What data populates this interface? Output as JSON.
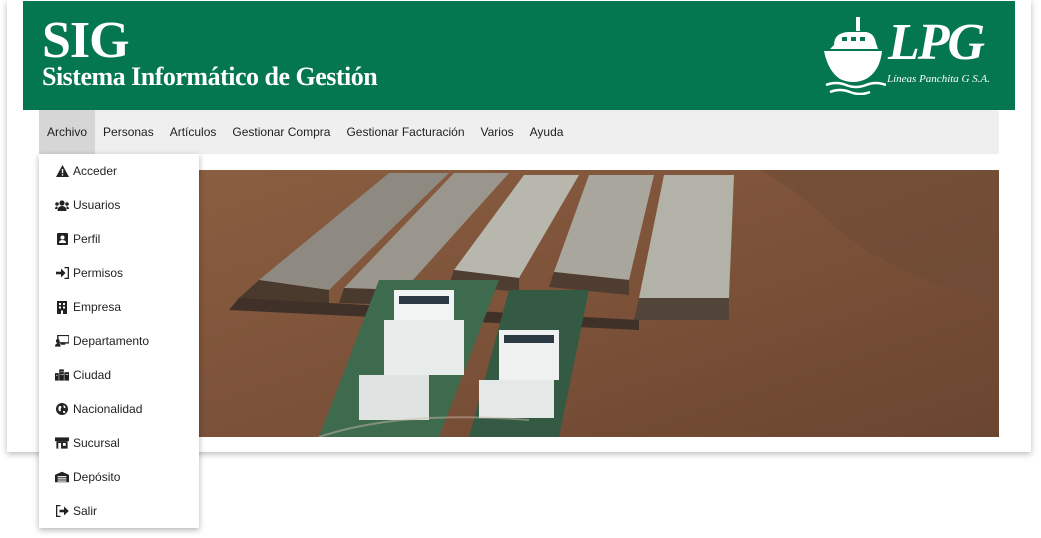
{
  "header": {
    "title": "SIG",
    "subtitle": "Sistema Informático de Gestión",
    "logo_text": "LPG",
    "logo_subtitle": "Líneas Panchita G S.A.",
    "background_color": "#047750"
  },
  "navbar": {
    "items": [
      {
        "label": "Archivo",
        "active": true
      },
      {
        "label": "Personas"
      },
      {
        "label": "Artículos"
      },
      {
        "label": "Gestionar Compra"
      },
      {
        "label": "Gestionar Facturación"
      },
      {
        "label": "Varios"
      },
      {
        "label": "Ayuda"
      }
    ]
  },
  "archivo_menu": {
    "items": [
      {
        "label": "Acceder",
        "icon": "warning-icon"
      },
      {
        "label": "Usuarios",
        "icon": "users-icon"
      },
      {
        "label": "Perfil",
        "icon": "profile-card-icon"
      },
      {
        "label": "Permisos",
        "icon": "sign-in-icon"
      },
      {
        "label": "Empresa",
        "icon": "building-icon"
      },
      {
        "label": "Departamento",
        "icon": "chalkboard-teacher-icon"
      },
      {
        "label": "Ciudad",
        "icon": "city-icon"
      },
      {
        "label": "Nacionalidad",
        "icon": "globe-icon"
      },
      {
        "label": "Sucursal",
        "icon": "store-icon"
      },
      {
        "label": "Depósito",
        "icon": "warehouse-icon"
      },
      {
        "label": "Salir",
        "icon": "sign-out-icon"
      }
    ]
  }
}
